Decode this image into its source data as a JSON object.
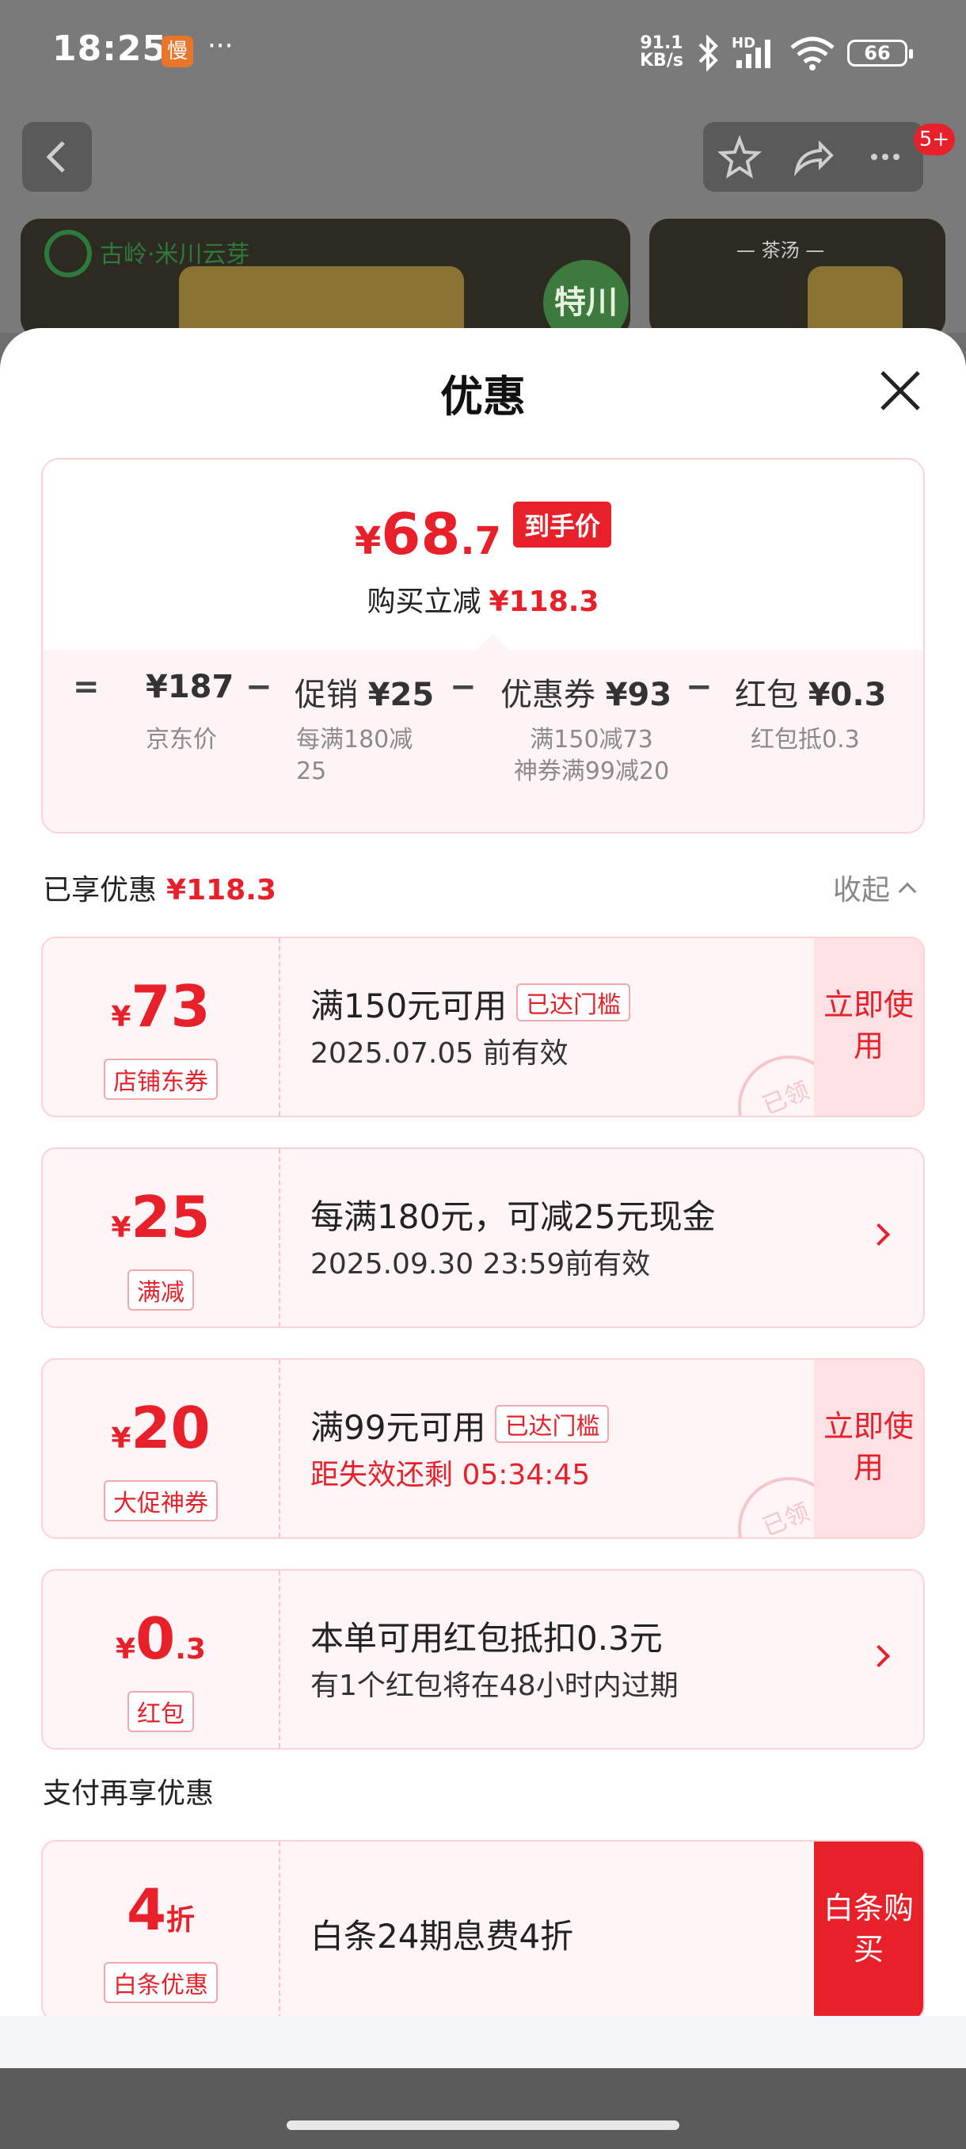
{
  "status_bar": {
    "time": "18:25",
    "app_badge": "慢",
    "more": "···",
    "net_speed_value": "91.1",
    "net_speed_unit": "KB/s",
    "hd": "HD",
    "battery": "66"
  },
  "background": {
    "message_badge": "5+",
    "product_tag": "特川",
    "tea_label": "— 茶汤 —",
    "brand_text": "古岭·米川云芽"
  },
  "sheet": {
    "title": "优惠",
    "price": {
      "yen": "¥",
      "final_int": "68",
      "final_dec": ".7",
      "final_tag": "到手价",
      "saving_label": "购买立减",
      "saving_amount": "¥118.3"
    },
    "breakdown": {
      "jd_price": "¥187",
      "jd_price_label": "京东价",
      "promo_label": "促销",
      "promo_amount": "¥25",
      "promo_desc_1": "每满180减",
      "promo_desc_2": "25",
      "coupon_label": "优惠券",
      "coupon_amount": "¥93",
      "coupon_desc_1": "满150减73",
      "coupon_desc_2": "神券满99减20",
      "redpack_label": "红包",
      "redpack_amount": "¥0.3",
      "redpack_desc": "红包抵0.3"
    },
    "enjoyed_label": "已享优惠",
    "enjoyed_amount": "¥118.3",
    "collapse_label": "收起",
    "coupons": [
      {
        "yen": "¥",
        "amount": "73",
        "type": "店铺东券",
        "line1": "满150元可用",
        "tag": "已达门槛",
        "line2": "2025.07.05 前有效",
        "action": "立即使用",
        "stamp": "已领"
      },
      {
        "yen": "¥",
        "amount": "25",
        "type": "满减",
        "line1": "每满180元，可减25元现金",
        "line2": "2025.09.30 23:59前有效"
      },
      {
        "yen": "¥",
        "amount": "20",
        "type": "大促神券",
        "line1": "满99元可用",
        "tag": "已达门槛",
        "line2": "距失效还剩 05:34:45",
        "action": "立即使用",
        "stamp": "已领"
      },
      {
        "yen": "¥",
        "amount": "0",
        "amount_dec": ".3",
        "type": "红包",
        "line1": "本单可用红包抵扣0.3元",
        "line2": "有1个红包将在48小时内过期"
      }
    ],
    "pay_title": "支付再享优惠",
    "pay_offer": {
      "amount": "4",
      "unit": "折",
      "type": "白条优惠",
      "line1": "白条24期息费4折",
      "action": "白条购买"
    }
  }
}
